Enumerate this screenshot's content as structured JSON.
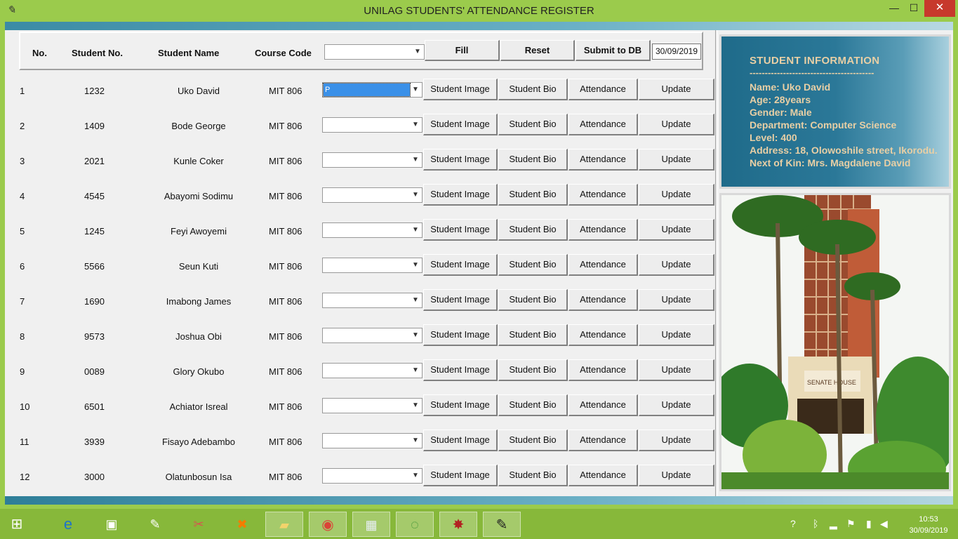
{
  "window": {
    "title": "UNILAG STUDENTS' ATTENDANCE REGISTER",
    "minimize": "—",
    "maximize": "☐",
    "close": "✕"
  },
  "header": {
    "no": "No.",
    "student_no": "Student No.",
    "student_name": "Student Name",
    "course_code": "Course Code",
    "select_value": "",
    "fill": "Fill",
    "reset": "Reset",
    "submit": "Submit to DB",
    "date": "30/09/2019"
  },
  "row_buttons": {
    "image": "Student Image",
    "bio": "Student Bio",
    "attendance": "Attendance",
    "update": "Update"
  },
  "rows": [
    {
      "no": "1",
      "student_no": "1232",
      "name": "Uko David",
      "course": "MIT 806",
      "status": "P"
    },
    {
      "no": "2",
      "student_no": "1409",
      "name": "Bode George",
      "course": "MIT 806",
      "status": ""
    },
    {
      "no": "3",
      "student_no": "2021",
      "name": "Kunle Coker",
      "course": "MIT 806",
      "status": ""
    },
    {
      "no": "4",
      "student_no": "4545",
      "name": "Abayomi Sodimu",
      "course": "MIT 806",
      "status": ""
    },
    {
      "no": "5",
      "student_no": "1245",
      "name": "Feyi Awoyemi",
      "course": "MIT 806",
      "status": ""
    },
    {
      "no": "6",
      "student_no": "5566",
      "name": "Seun Kuti",
      "course": "MIT 806",
      "status": ""
    },
    {
      "no": "7",
      "student_no": "1690",
      "name": "Imabong James",
      "course": "MIT 806",
      "status": ""
    },
    {
      "no": "8",
      "student_no": "9573",
      "name": "Joshua Obi",
      "course": "MIT 806",
      "status": ""
    },
    {
      "no": "9",
      "student_no": "0089",
      "name": "Glory Okubo",
      "course": "MIT 806",
      "status": ""
    },
    {
      "no": "10",
      "student_no": "6501",
      "name": "Achiator Isreal",
      "course": "MIT 806",
      "status": ""
    },
    {
      "no": "11",
      "student_no": "3939",
      "name": "Fisayo Adebambo",
      "course": "MIT 806",
      "status": ""
    },
    {
      "no": "12",
      "student_no": "3000",
      "name": "Olatunbosun Isa",
      "course": "MIT 806",
      "status": ""
    }
  ],
  "info": {
    "heading": "STUDENT  INFORMATION",
    "rule": "-----------------------------------------",
    "name": "Name:  Uko David",
    "age": "Age:  28years",
    "gender": "Gender:  Male",
    "department": "Department:  Computer Science",
    "level": "Level:  400",
    "address": "Address:  18, Olowoshile street, Ikorodu.",
    "next_of_kin": "Next of Kin: Mrs. Magdalene David"
  },
  "photo_sign": "SENATE HOUSE",
  "taskbar": {
    "time": "10:53",
    "date": "30/09/2019"
  },
  "colors": {
    "window_frame": "#9bcb4c",
    "info_text": "#e8cfa5",
    "info_bg": "#2b7898",
    "selected": "#3a90e8"
  }
}
